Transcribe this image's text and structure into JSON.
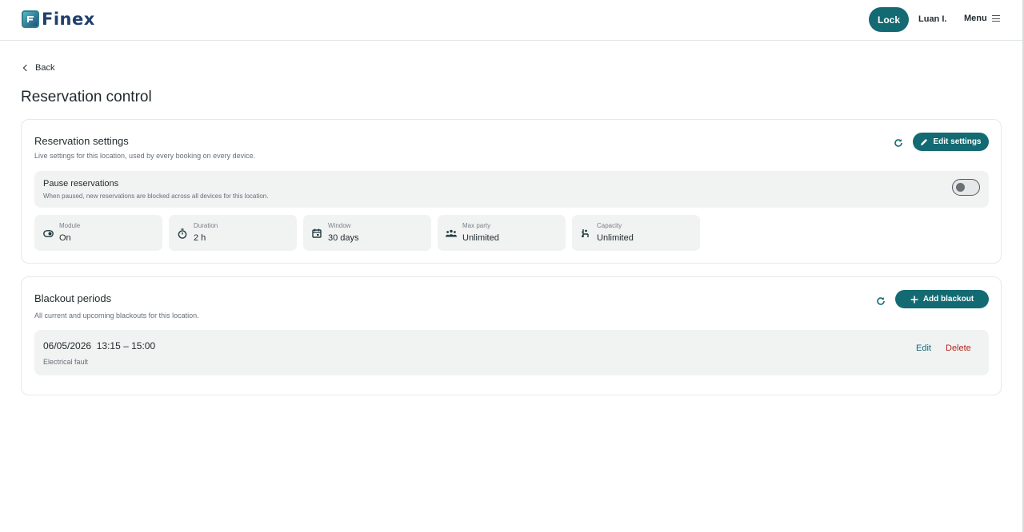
{
  "header": {
    "logo_text": "Finex",
    "lock_label": "Lock",
    "user_name": "Luan I.",
    "menu_label": "Menu"
  },
  "nav": {
    "back_label": "Back"
  },
  "page": {
    "title": "Reservation control"
  },
  "settings": {
    "title": "Reservation settings",
    "subtitle": "Live settings for this location, used by every booking on every device.",
    "edit_label": "Edit settings",
    "pause": {
      "title": "Pause reservations",
      "description": "When paused, new reservations are blocked across all devices for this location.",
      "enabled": false
    },
    "stats": [
      {
        "label": "Module",
        "value": "On",
        "icon": "toggle-icon"
      },
      {
        "label": "Duration",
        "value": "2 h",
        "icon": "stopwatch-icon"
      },
      {
        "label": "Window",
        "value": "30 days",
        "icon": "calendar-icon"
      },
      {
        "label": "Max party",
        "value": "Unlimited",
        "icon": "group-icon"
      },
      {
        "label": "Capacity",
        "value": "Unlimited",
        "icon": "seat-icon"
      }
    ]
  },
  "blackouts": {
    "title": "Blackout periods",
    "subtitle": "All current and upcoming blackouts for this location.",
    "add_label": "Add blackout",
    "items": [
      {
        "when": "06/05/2026  13:15 – 15:00",
        "reason": "Electrical fault",
        "edit_label": "Edit",
        "delete_label": "Delete"
      }
    ]
  },
  "colors": {
    "accent": "#136a72",
    "danger": "#b3261e",
    "panel": "#f1f2f2"
  }
}
